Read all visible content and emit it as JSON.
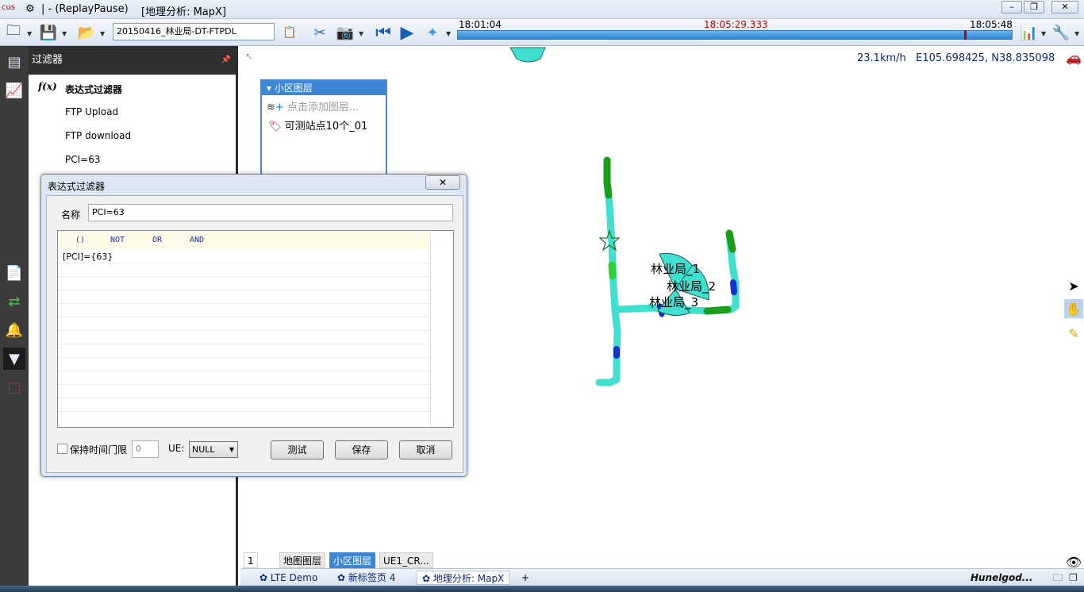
{
  "titlebar": {
    "app_name": "ReplayPause",
    "title_text": "| - (ReplayPause)",
    "window_title": "[地理分析: MapX]"
  },
  "toolbar": {
    "file_name": "20150416_林业局-DT-FTPDL",
    "time_start": "18:01:04",
    "time_current": "18:05:29.333",
    "time_end": "18:05:48",
    "progress_fraction": 0.915
  },
  "filter_panel": {
    "title": "过滤器",
    "items": [
      "表达式过滤器",
      "FTP Upload",
      "FTP download",
      "PCI=63"
    ]
  },
  "layer_panel": {
    "title": "小区图层",
    "add_hint": "点击添加图层...",
    "layer_name": "可测站点10个_01"
  },
  "map": {
    "speed": "23.1km/h",
    "coords": "E105.698425, N38.835098",
    "cell_labels": [
      "林业局_1",
      "林业局_2",
      "林业局_3"
    ],
    "route_color": "#40e0d0",
    "good_signal_color": "#1a9e1a",
    "poor_signal_color": "#1a2fd0"
  },
  "dialog": {
    "title": "表达式过滤器",
    "close_symbol": "✕",
    "name_label": "名称",
    "name_value": "PCI=63",
    "operators": [
      "()",
      "NOT",
      "OR",
      "AND"
    ],
    "expression": "[PCI]={63}",
    "keep_time_label": "保持时间门限",
    "keep_time_value": "0",
    "ue_label": "UE:",
    "ue_value": "NULL",
    "test_button": "测试",
    "save_button": "保存",
    "cancel_button": "取消"
  },
  "layer_tabs": {
    "page_number": "1",
    "tabs": [
      "地图图层",
      "小区图层",
      "UE1_CR..."
    ]
  },
  "page_tabs": {
    "tabs": [
      "LTE Demo",
      "新标签页 4",
      "地理分析: MapX"
    ],
    "add_symbol": "+"
  },
  "branding": "Hunelgod..."
}
